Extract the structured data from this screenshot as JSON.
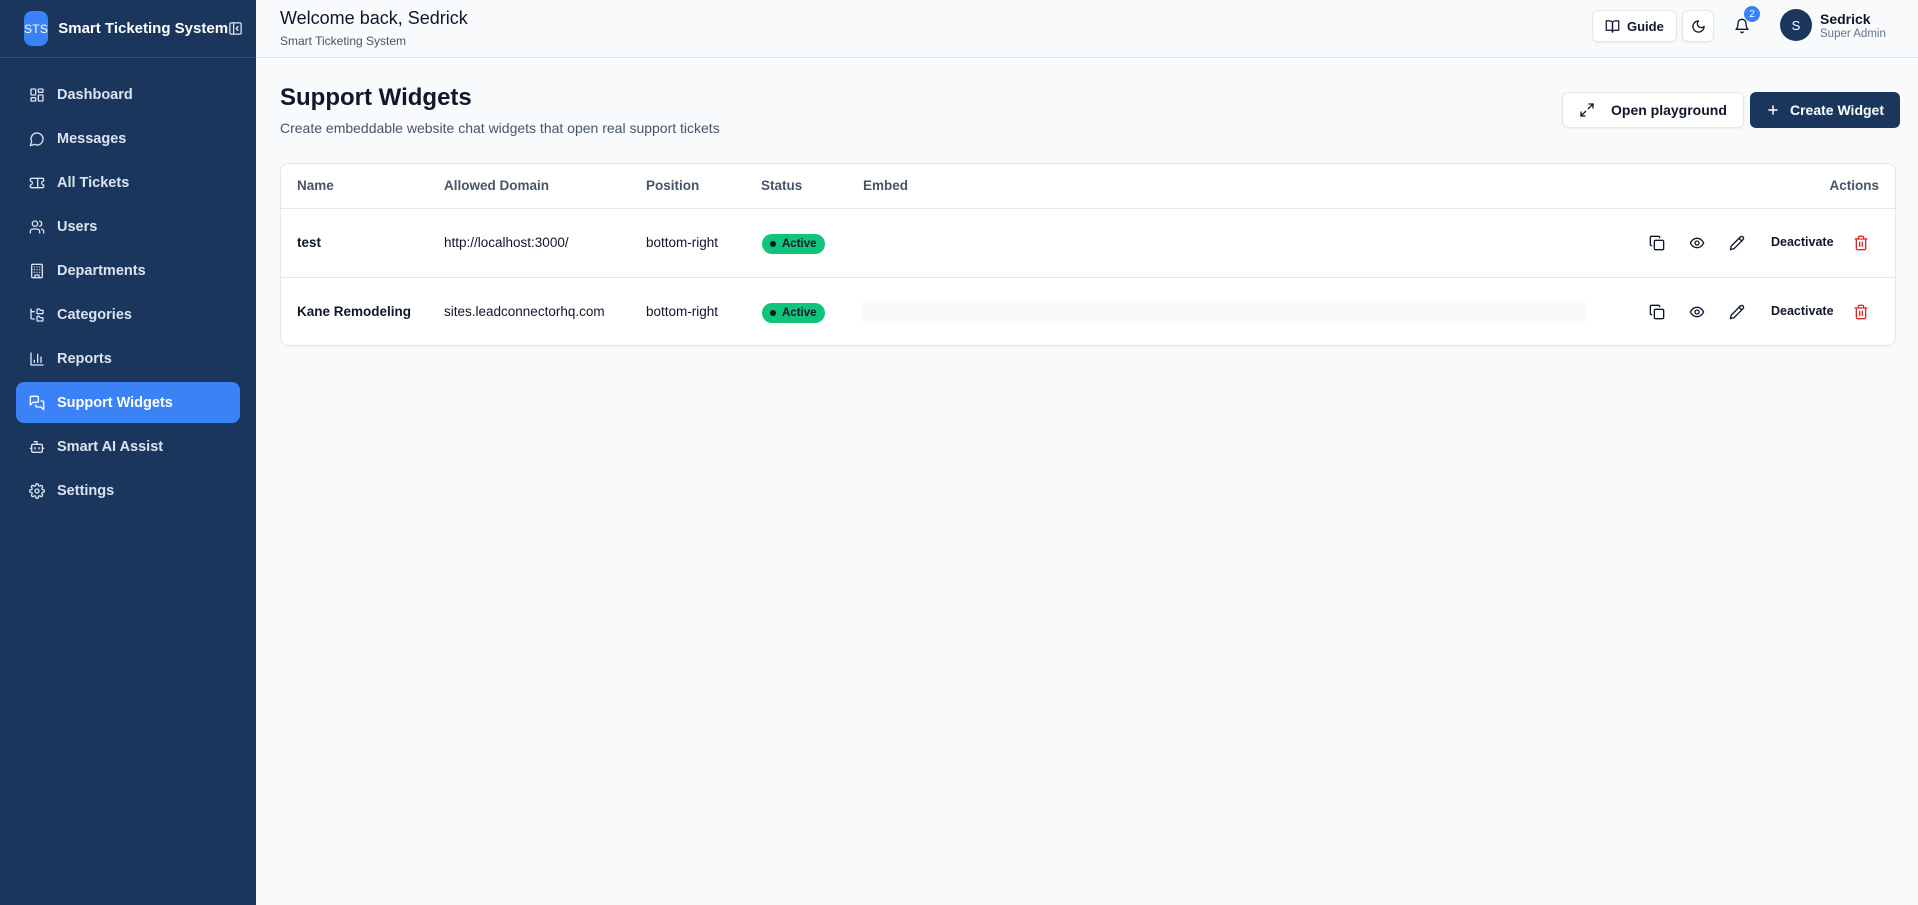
{
  "sidebar": {
    "logo": "STS",
    "app_name": "Smart Ticketing System",
    "items": [
      {
        "label": "Dashboard",
        "icon": "grid-icon"
      },
      {
        "label": "Messages",
        "icon": "chat-icon"
      },
      {
        "label": "All Tickets",
        "icon": "ticket-icon"
      },
      {
        "label": "Users",
        "icon": "users-icon"
      },
      {
        "label": "Departments",
        "icon": "building-icon"
      },
      {
        "label": "Categories",
        "icon": "tree-icon"
      },
      {
        "label": "Reports",
        "icon": "bar-chart-icon"
      },
      {
        "label": "Support Widgets",
        "icon": "chat-bubbles-icon",
        "active": true
      },
      {
        "label": "Smart AI Assist",
        "icon": "bot-icon"
      },
      {
        "label": "Settings",
        "icon": "gear-icon"
      }
    ]
  },
  "header": {
    "greeting": "Welcome back, Sedrick",
    "subtitle": "Smart Ticketing System",
    "guide_label": "Guide",
    "notification_count": "2",
    "user": {
      "initial": "S",
      "name": "Sedrick",
      "role": "Super Admin"
    }
  },
  "main": {
    "title": "Support Widgets",
    "subtitle": "Create embeddable website chat widgets that open real support tickets",
    "open_playground_label": "Open playground",
    "create_widget_label": "Create Widget",
    "table": {
      "headers": {
        "name": "Name",
        "domain": "Allowed Domain",
        "position": "Position",
        "status": "Status",
        "embed": "Embed",
        "actions": "Actions"
      },
      "rows": [
        {
          "name": "test",
          "domain": "http://localhost:3000/",
          "position": "bottom-right",
          "status": "Active",
          "action_label": "Deactivate"
        },
        {
          "name": "Kane Remodeling",
          "domain": "sites.leadconnectorhq.com",
          "position": "bottom-right",
          "status": "Active",
          "action_label": "Deactivate"
        }
      ]
    }
  },
  "colors": {
    "sidebar_bg": "#1b365d",
    "accent": "#3b82f6",
    "primary_button": "#1b365d",
    "active_badge": "#10c47c",
    "danger": "#dc2626"
  }
}
